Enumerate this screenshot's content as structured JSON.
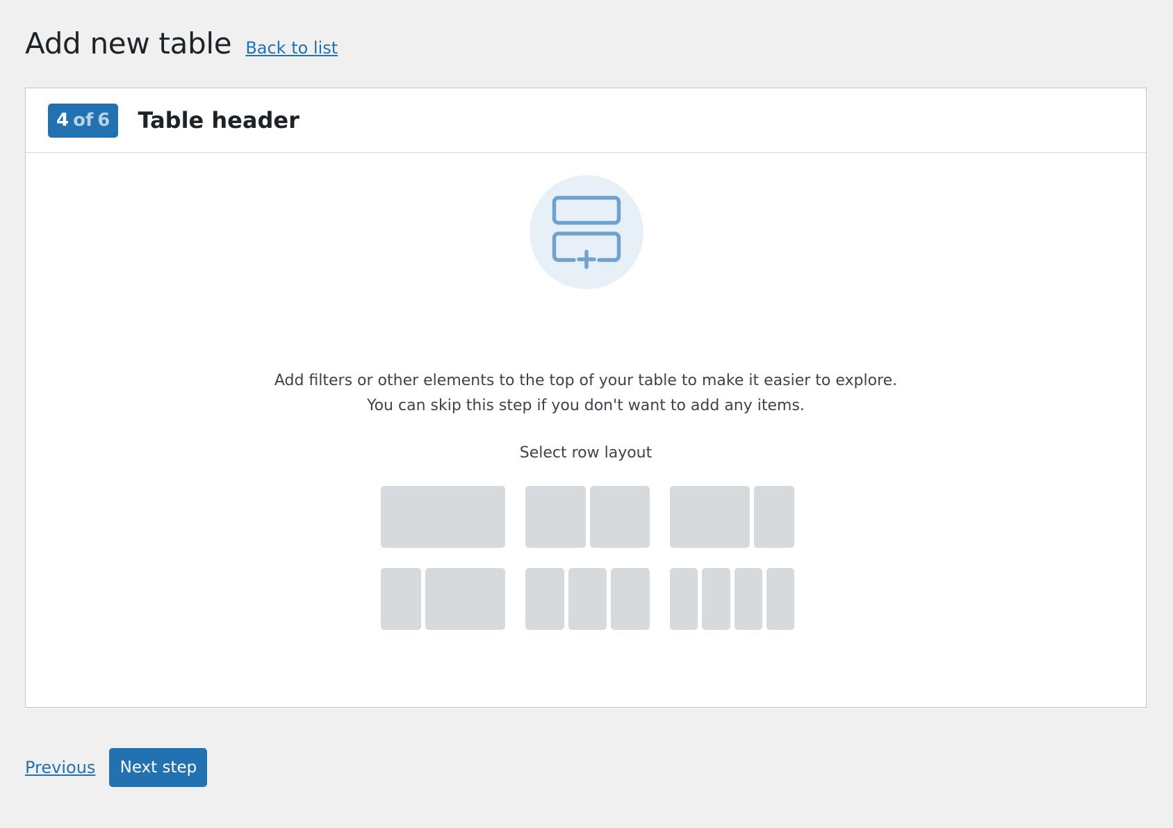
{
  "header": {
    "title": "Add new table",
    "back_link": "Back to list"
  },
  "panel": {
    "step": {
      "current": "4",
      "of": "of",
      "total": "6"
    },
    "title": "Table header",
    "icon": "table-header-add-icon",
    "description_line1": "Add filters or other elements to the top of your table to make it easier to explore.",
    "description_line2": "You can skip this step if you don't want to add any items.",
    "layout_label": "Select row layout",
    "layout_options": [
      {
        "name": "1 column",
        "columns": [
          1
        ]
      },
      {
        "name": "2 equal columns",
        "columns": [
          1,
          1
        ]
      },
      {
        "name": "2 columns wide-narrow",
        "columns": [
          2,
          1
        ]
      },
      {
        "name": "2 columns narrow-wide",
        "columns": [
          1,
          2
        ]
      },
      {
        "name": "3 equal columns",
        "columns": [
          1,
          1,
          1
        ]
      },
      {
        "name": "4 equal columns",
        "columns": [
          1,
          1,
          1,
          1
        ]
      }
    ]
  },
  "footer": {
    "previous": "Previous",
    "next": "Next step"
  },
  "colors": {
    "primary": "#2271b1",
    "background": "#f0f0f1",
    "layout_cell": "#d7dadd",
    "icon_circle": "#e7eff7",
    "icon_stroke": "#6fa2cf"
  }
}
